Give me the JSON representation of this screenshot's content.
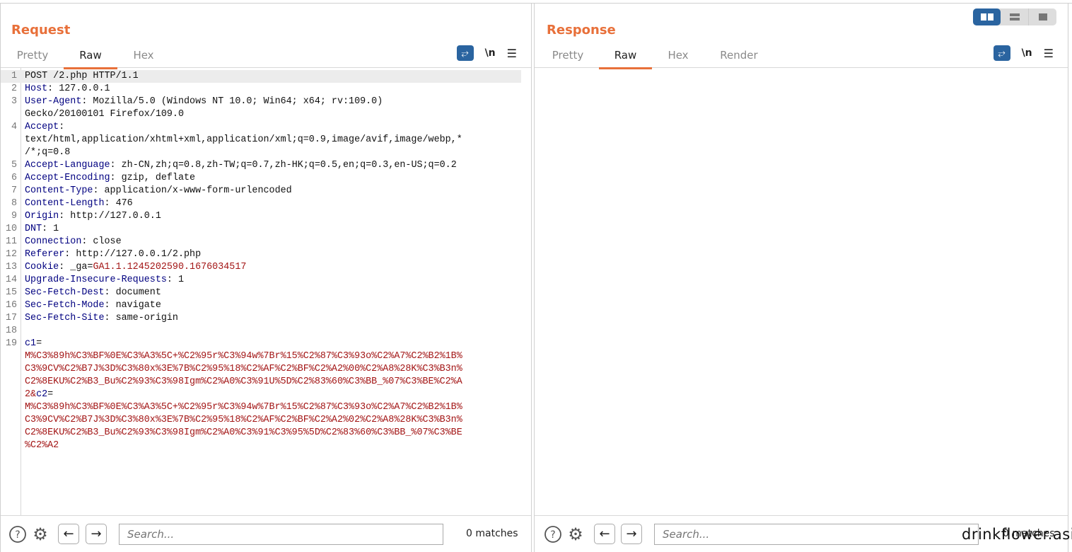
{
  "request": {
    "title": "Request",
    "tabs": [
      {
        "label": "Pretty",
        "active": false
      },
      {
        "label": "Raw",
        "active": true
      },
      {
        "label": "Hex",
        "active": false
      }
    ],
    "newline_label": "\\n",
    "lines": [
      {
        "n": "1",
        "parts": [
          {
            "t": "POST /2.php HTTP/1.1",
            "c": "v"
          }
        ]
      },
      {
        "n": "2",
        "parts": [
          {
            "t": "Host",
            "c": "k"
          },
          {
            "t": ": 127.0.0.1",
            "c": "v"
          }
        ]
      },
      {
        "n": "3",
        "parts": [
          {
            "t": "User-Agent",
            "c": "k"
          },
          {
            "t": ": Mozilla/5.0 (Windows NT 10.0; Win64; x64; rv:109.0)",
            "c": "v"
          }
        ]
      },
      {
        "n": "",
        "parts": [
          {
            "t": "Gecko/20100101 Firefox/109.0",
            "c": "v"
          }
        ]
      },
      {
        "n": "4",
        "parts": [
          {
            "t": "Accept",
            "c": "k"
          },
          {
            "t": ":",
            "c": "v"
          }
        ]
      },
      {
        "n": "",
        "parts": [
          {
            "t": "text/html,application/xhtml+xml,application/xml;q=0.9,image/avif,image/webp,*",
            "c": "v"
          }
        ]
      },
      {
        "n": "",
        "parts": [
          {
            "t": "/*;q=0.8",
            "c": "v"
          }
        ]
      },
      {
        "n": "5",
        "parts": [
          {
            "t": "Accept-Language",
            "c": "k"
          },
          {
            "t": ": zh-CN,zh;q=0.8,zh-TW;q=0.7,zh-HK;q=0.5,en;q=0.3,en-US;q=0.2",
            "c": "v"
          }
        ]
      },
      {
        "n": "6",
        "parts": [
          {
            "t": "Accept-Encoding",
            "c": "k"
          },
          {
            "t": ": gzip, deflate",
            "c": "v"
          }
        ]
      },
      {
        "n": "7",
        "parts": [
          {
            "t": "Content-Type",
            "c": "k"
          },
          {
            "t": ": application/x-www-form-urlencoded",
            "c": "v"
          }
        ]
      },
      {
        "n": "8",
        "parts": [
          {
            "t": "Content-Length",
            "c": "k"
          },
          {
            "t": ": 476",
            "c": "v"
          }
        ]
      },
      {
        "n": "9",
        "parts": [
          {
            "t": "Origin",
            "c": "k"
          },
          {
            "t": ": http://127.0.0.1",
            "c": "v"
          }
        ]
      },
      {
        "n": "10",
        "parts": [
          {
            "t": "DNT",
            "c": "k"
          },
          {
            "t": ": 1",
            "c": "v"
          }
        ]
      },
      {
        "n": "11",
        "parts": [
          {
            "t": "Connection",
            "c": "k"
          },
          {
            "t": ": close",
            "c": "v"
          }
        ]
      },
      {
        "n": "12",
        "parts": [
          {
            "t": "Referer",
            "c": "k"
          },
          {
            "t": ": http://127.0.0.1/2.php",
            "c": "v"
          }
        ]
      },
      {
        "n": "13",
        "parts": [
          {
            "t": "Cookie",
            "c": "k"
          },
          {
            "t": ": _ga=",
            "c": "v"
          },
          {
            "t": "GA1.1.1245202590.1676034517",
            "c": "r"
          }
        ]
      },
      {
        "n": "14",
        "parts": [
          {
            "t": "Upgrade-Insecure-Requests",
            "c": "k"
          },
          {
            "t": ": 1",
            "c": "v"
          }
        ]
      },
      {
        "n": "15",
        "parts": [
          {
            "t": "Sec-Fetch-Dest",
            "c": "k"
          },
          {
            "t": ": document",
            "c": "v"
          }
        ]
      },
      {
        "n": "16",
        "parts": [
          {
            "t": "Sec-Fetch-Mode",
            "c": "k"
          },
          {
            "t": ": navigate",
            "c": "v"
          }
        ]
      },
      {
        "n": "17",
        "parts": [
          {
            "t": "Sec-Fetch-Site",
            "c": "k"
          },
          {
            "t": ": same-origin",
            "c": "v"
          }
        ]
      },
      {
        "n": "18",
        "parts": [
          {
            "t": "",
            "c": "v"
          }
        ]
      },
      {
        "n": "19",
        "parts": [
          {
            "t": "c1",
            "c": "k"
          },
          {
            "t": "=",
            "c": "v"
          }
        ]
      },
      {
        "n": "",
        "parts": [
          {
            "t": "M%C3%89h%C3%BF%0E%C3%A3%5C+%C2%95r%C3%94w%7Br%15%C2%87%C3%93o%C2%A7%C2%B2%1B%",
            "c": "r"
          }
        ]
      },
      {
        "n": "",
        "parts": [
          {
            "t": "C3%9CV%C2%B7J%3D%C3%80x%3E%7B%C2%95%18%C2%AF%C2%BF%C2%A2%00%C2%A8%28K%C3%B3n%",
            "c": "r"
          }
        ]
      },
      {
        "n": "",
        "parts": [
          {
            "t": "C2%8EKU%C2%B3_Bu%C2%93%C3%98Igm%C2%A0%C3%91U%5D%C2%83%60%C3%BB_%07%C3%BE%C2%A",
            "c": "r"
          }
        ]
      },
      {
        "n": "",
        "parts": [
          {
            "t": "2&",
            "c": "r"
          },
          {
            "t": "c2",
            "c": "k"
          },
          {
            "t": "=",
            "c": "v"
          }
        ]
      },
      {
        "n": "",
        "parts": [
          {
            "t": "M%C3%89h%C3%BF%0E%C3%A3%5C+%C2%95r%C3%94w%7Br%15%C2%87%C3%93o%C2%A7%C2%B2%1B%",
            "c": "r"
          }
        ]
      },
      {
        "n": "",
        "parts": [
          {
            "t": "C3%9CV%C2%B7J%3D%C3%80x%3E%7B%C2%95%18%C2%AF%C2%BF%C2%A2%02%C2%A8%28K%C3%B3n%",
            "c": "r"
          }
        ]
      },
      {
        "n": "",
        "parts": [
          {
            "t": "C2%8EKU%C2%B3_Bu%C2%93%C3%98Igm%C2%A0%C3%91%C3%95%5D%C2%83%60%C3%BB_%07%C3%BE",
            "c": "r"
          }
        ]
      },
      {
        "n": "",
        "parts": [
          {
            "t": "%C2%A2",
            "c": "r"
          }
        ]
      }
    ],
    "search_placeholder": "Search...",
    "matches": "0 matches"
  },
  "response": {
    "title": "Response",
    "tabs": [
      {
        "label": "Pretty",
        "active": false
      },
      {
        "label": "Raw",
        "active": true
      },
      {
        "label": "Hex",
        "active": false
      },
      {
        "label": "Render",
        "active": false
      }
    ],
    "newline_label": "\\n",
    "search_placeholder": "Search...",
    "matches": "0 matches"
  },
  "layout_modes": [
    "side-by-side",
    "stacked",
    "single"
  ],
  "layout_selected": "side-by-side",
  "watermark": "drinkflower.asia",
  "colors": {
    "accent": "#e8703a",
    "button_blue": "#2a64a0",
    "header_name": "#000080",
    "param_value": "#a31515"
  }
}
